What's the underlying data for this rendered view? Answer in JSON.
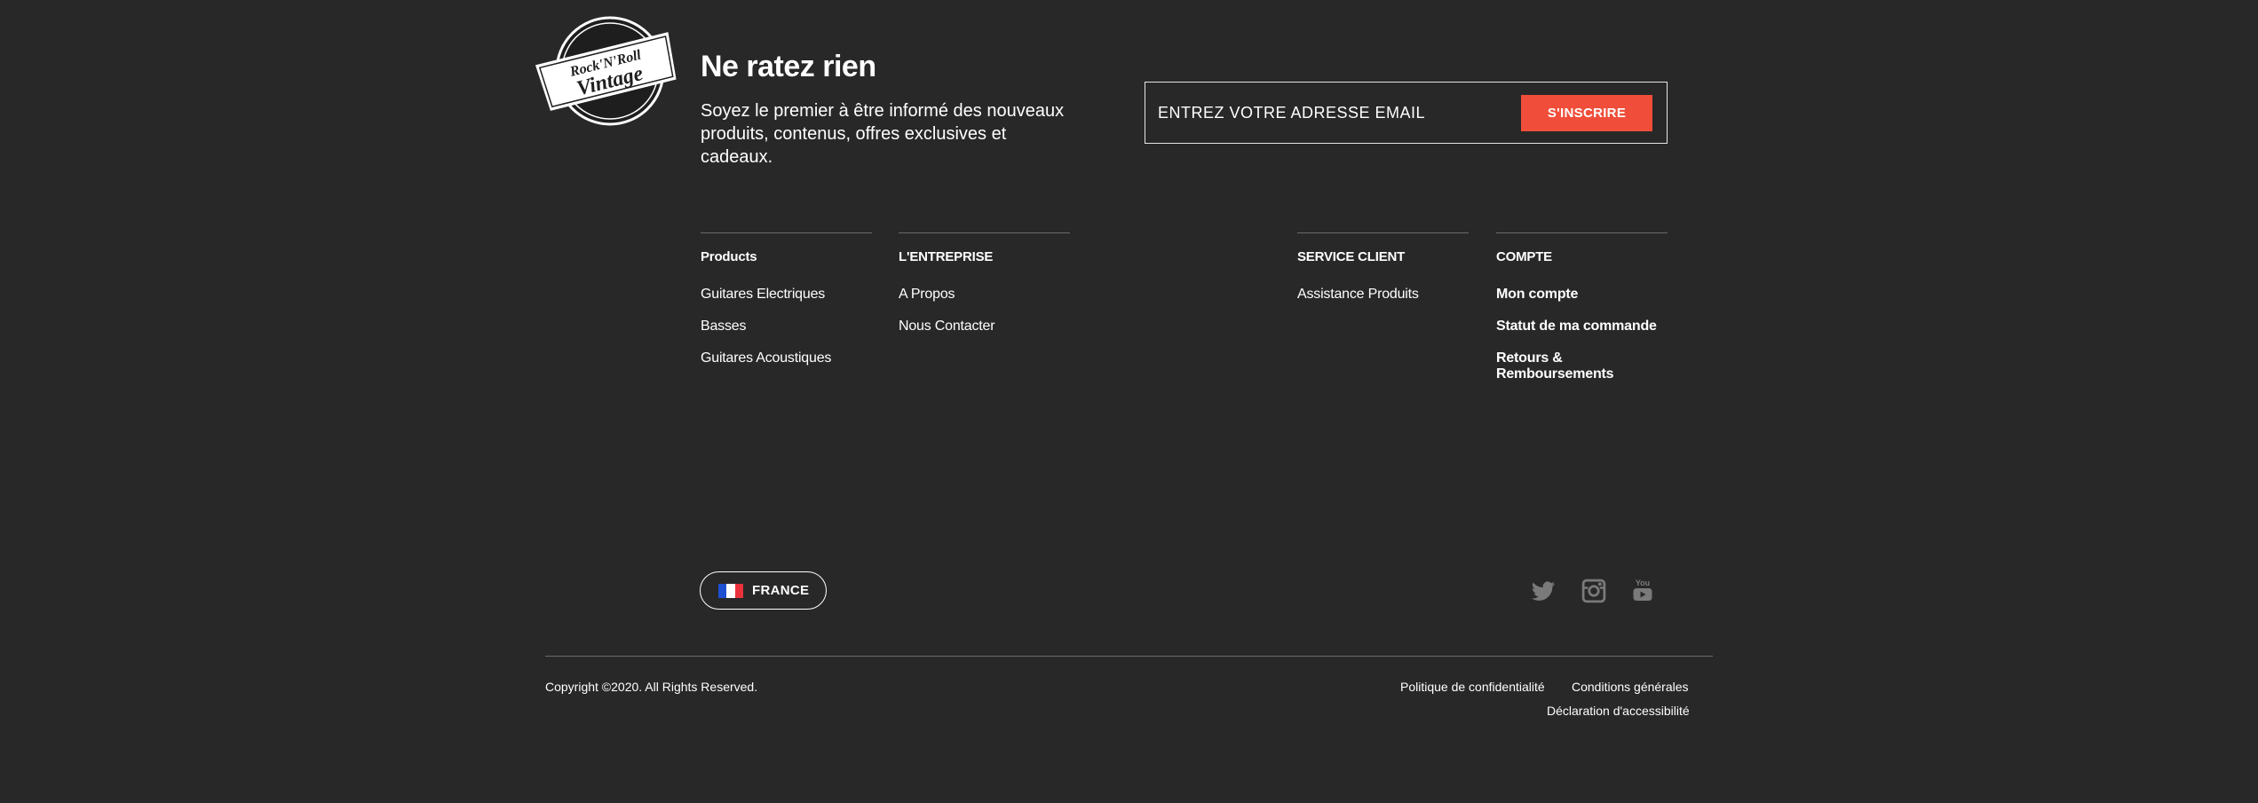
{
  "brand": {
    "logo_line1": "Rock'N'Roll",
    "logo_line2": "Vintage"
  },
  "newsletter": {
    "title": "Ne ratez rien",
    "text": "Soyez le premier à être informé des nouveaux produits, contenus, offres exclusives et cadeaux.",
    "email_placeholder": "ENTREZ VOTRE ADRESSE EMAIL",
    "button_label": "S'INSCRIRE",
    "button_color": "#f04e3a"
  },
  "footer": {
    "columns": [
      {
        "heading": "Products",
        "links": [
          "Guitares Electriques",
          "Basses",
          "Guitares Acoustiques"
        ]
      },
      {
        "heading": "L'ENTREPRISE",
        "links": [
          "A Propos",
          "Nous Contacter"
        ]
      },
      {
        "heading": "SERVICE CLIENT",
        "links": [
          "Assistance Produits"
        ]
      },
      {
        "heading": "COMPTE",
        "links": [
          "Mon compte",
          "Statut de ma commande",
          "Retours & Remboursements"
        ]
      }
    ]
  },
  "country_selector": {
    "label": "FRANCE",
    "flag_colors": [
      "#1d4fd1",
      "#ffffff",
      "#e9323c"
    ]
  },
  "social": {
    "icons": [
      "twitter-icon",
      "instagram-icon",
      "youtube-icon"
    ],
    "icon_color": "#7a7a7a",
    "youtube_label": "You"
  },
  "bottom": {
    "copyright": "Copyright ©2020. All Rights Reserved.",
    "privacy": "Politique de confidentialité",
    "terms": "Conditions générales",
    "accessibility": "Déclaration d'accessibilité"
  },
  "colors": {
    "background": "#282828",
    "divider": "#6a6a6a"
  }
}
